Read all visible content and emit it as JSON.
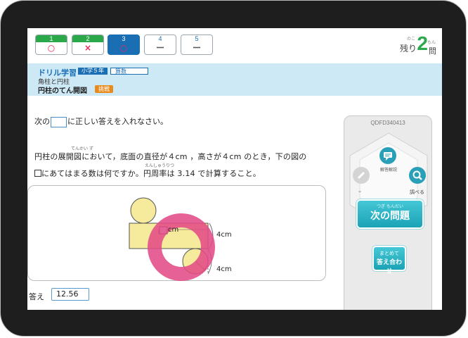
{
  "progress": {
    "questions": [
      {
        "number": "1",
        "mark": "○",
        "state": "correct"
      },
      {
        "number": "2",
        "mark": "×",
        "state": "wrong"
      },
      {
        "number": "3",
        "mark": "○",
        "state": "current"
      },
      {
        "number": "4",
        "mark": "ー",
        "state": "pending"
      },
      {
        "number": "5",
        "mark": "ー",
        "state": "pending"
      }
    ],
    "remaining_label": "残り",
    "remaining_ruby": "のこ",
    "remaining_count": "2",
    "remaining_unit": "問",
    "remaining_unit_ruby": "もん"
  },
  "header": {
    "drill_label": "ドリル学習",
    "grade": "小学５年",
    "subject": "算数",
    "unit": "角柱と円柱",
    "lesson": "円柱のてん開図",
    "badge": "挑戦"
  },
  "question": {
    "instruction_pre": "次の",
    "instruction_post": "に正しい答えを入れなさい。",
    "ruby1": "てんかい  ず",
    "line1": "円柱の展開図において，底面の直径が４cm ，高さが４cm のとき，下の図の",
    "ruby2": "えんしゅうりつ",
    "line2_post": "にあてはまる数は何ですか。円周率は 3.14 で計算すること。",
    "figure": {
      "blank_unit": "cm",
      "height_label": "4cm",
      "diameter_label": "4cm"
    }
  },
  "answer": {
    "label": "答え",
    "value": "12.56"
  },
  "side_panel": {
    "question_id": "QDFD340413",
    "explain_label": "解答解説",
    "search_label": "調べる",
    "edit_label": "ｰ",
    "next_ruby": "つぎ    もんだい",
    "next_label": "次の問題",
    "check_line1": "まとめて",
    "check_line2": "答え合わせ"
  },
  "colors": {
    "accent": "#1a6fb4",
    "correct": "#2aa84a",
    "mark": "#e4275f",
    "header_bg": "#cde9f6",
    "button_teal": "#1aa3b6",
    "highlight_ring": "#e24b86"
  }
}
